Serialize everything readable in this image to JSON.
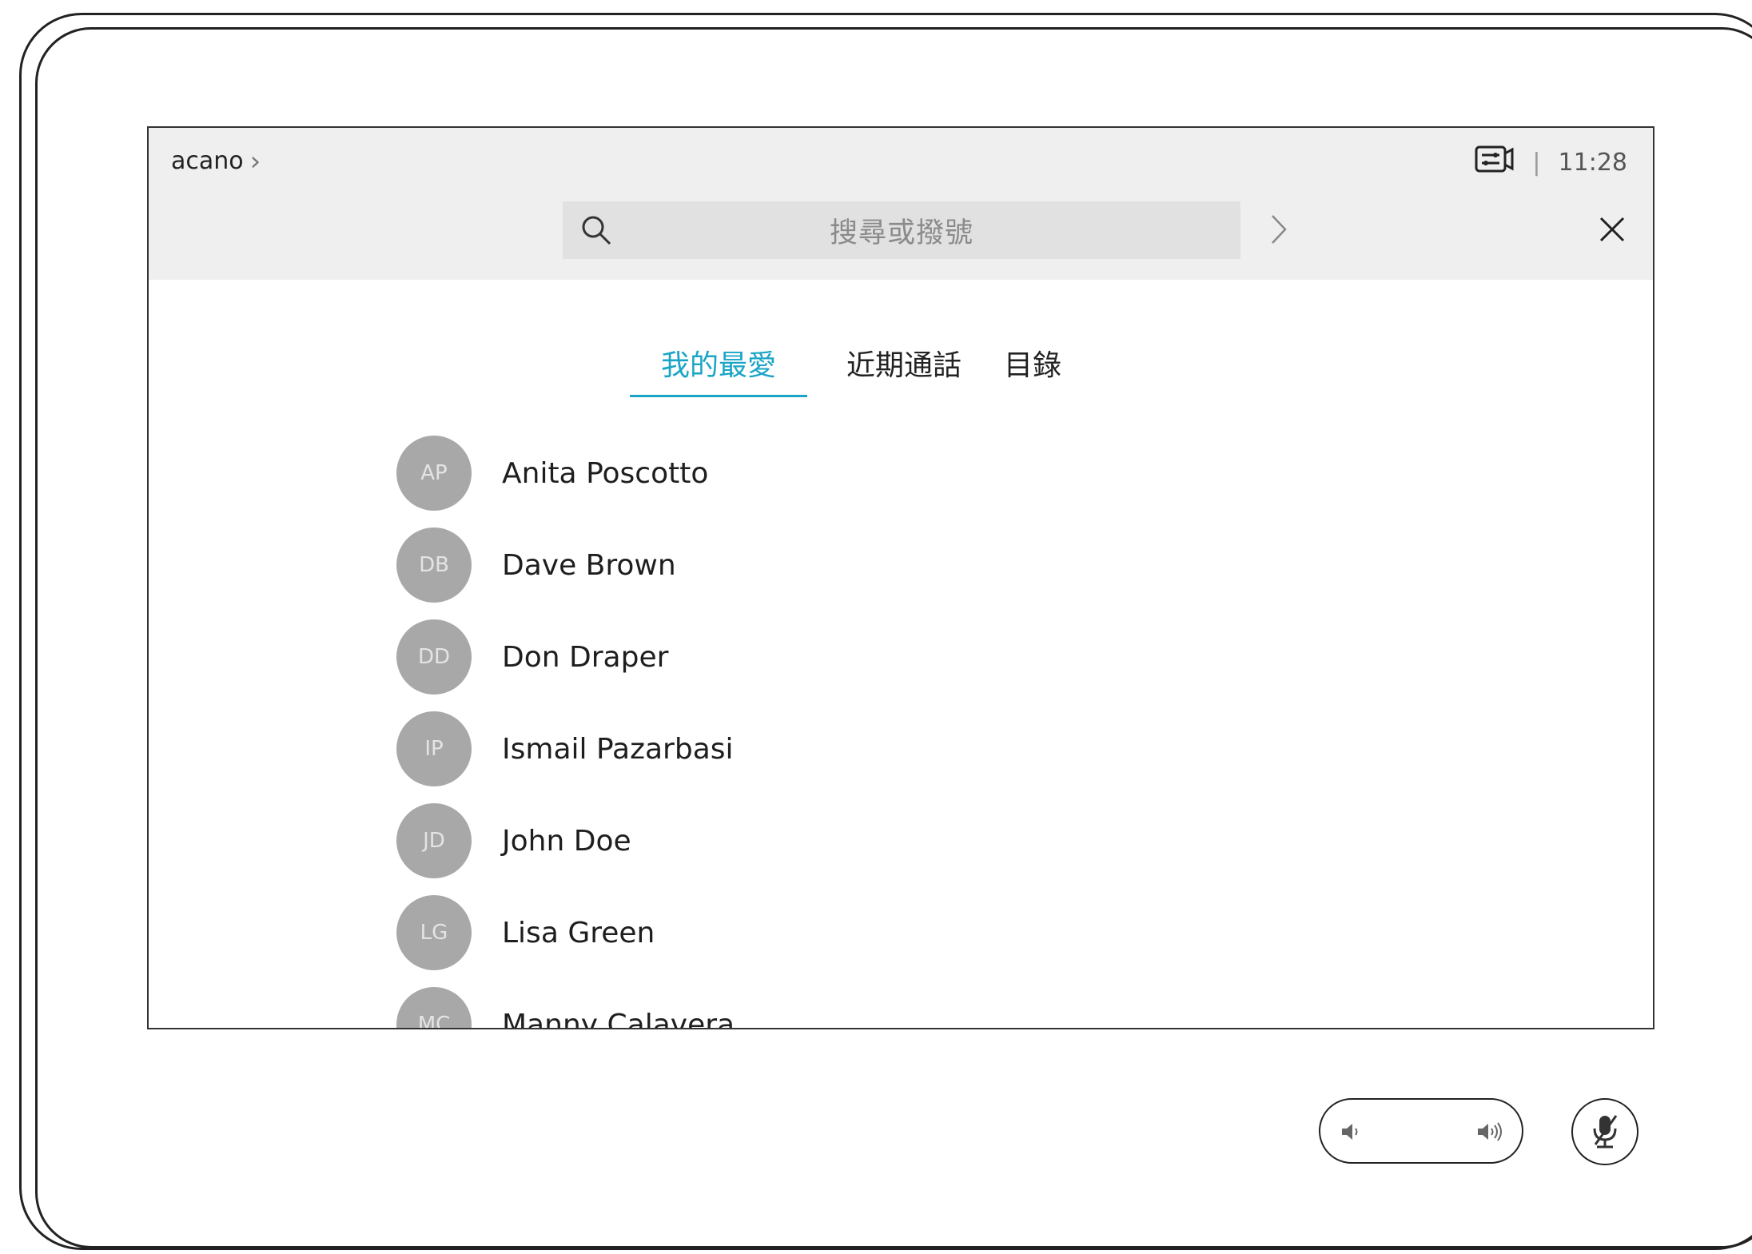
{
  "header": {
    "breadcrumb": "acano",
    "time": "11:28",
    "separator": "|"
  },
  "search": {
    "placeholder": "搜尋或撥號"
  },
  "tabs": [
    {
      "label": "我的最愛",
      "active": true
    },
    {
      "label": "近期通話",
      "active": false
    },
    {
      "label": "目錄",
      "active": false
    }
  ],
  "contacts": [
    {
      "initials": "AP",
      "name": "Anita Poscotto"
    },
    {
      "initials": "DB",
      "name": "Dave Brown"
    },
    {
      "initials": "DD",
      "name": "Don Draper"
    },
    {
      "initials": "IP",
      "name": "Ismail Pazarbasi"
    },
    {
      "initials": "JD",
      "name": "John Doe"
    },
    {
      "initials": "LG",
      "name": "Lisa Green"
    },
    {
      "initials": "MC",
      "name": "Manny Calavera"
    }
  ],
  "colors": {
    "accent": "#1aa5c6",
    "header_bg": "#efefef",
    "avatar_bg": "#a8a8a8"
  },
  "icons": {
    "search": "search-icon",
    "go": "chevron-right-icon",
    "close": "close-icon",
    "camera": "camera-settings-icon",
    "volume_down": "volume-down-icon",
    "volume_up": "volume-up-icon",
    "mute": "microphone-muted-icon"
  }
}
